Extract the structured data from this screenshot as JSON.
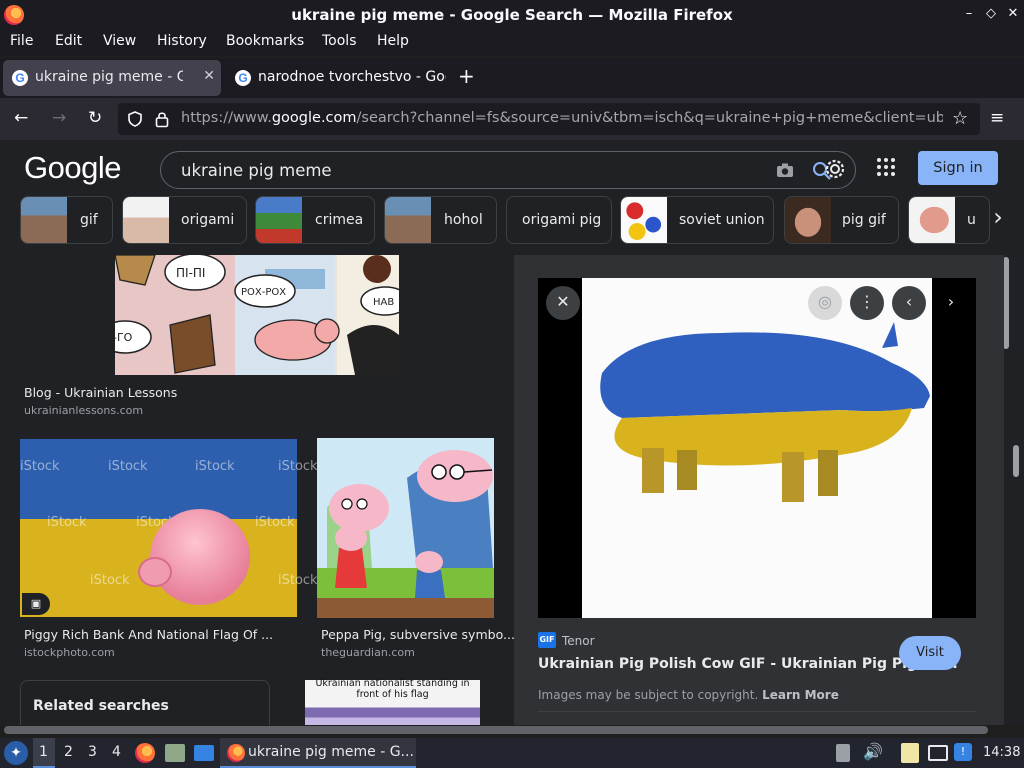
{
  "window": {
    "title": "ukraine pig meme - Google Search — Mozilla Firefox",
    "controls": [
      "–",
      "◇",
      "✕"
    ]
  },
  "menu": [
    "File",
    "Edit",
    "View",
    "History",
    "Bookmarks",
    "Tools",
    "Help"
  ],
  "tabs": [
    {
      "label": "ukraine pig meme - Google Search",
      "active": true
    },
    {
      "label": "narodnoe tvorchestvo - Google Search",
      "active": false
    }
  ],
  "navbar": {
    "url_prefix": "https://www.",
    "url_domain": "google.com",
    "url_rest": "/search?channel=fs&source=univ&tbm=isch&q=ukraine+pig+meme&client=ubuntu"
  },
  "google": {
    "logo": "Google",
    "query": "ukraine pig meme",
    "signin": "Sign in",
    "chips": [
      "gif",
      "origami",
      "crimea",
      "hohol",
      "origami pig",
      "soviet union",
      "pig gif",
      "u"
    ]
  },
  "results": [
    {
      "caption": "Blog - Ukrainian Lessons",
      "source": "ukrainianlessons.com"
    },
    {
      "caption": "Piggy Rich Bank And National Flag Of ...",
      "source": "istockphoto.com"
    },
    {
      "caption": "Peppa Pig, subversive symbo...",
      "source": "theguardian.com"
    }
  ],
  "comic_text": {
    "b1": "ПІ-ПІ",
    "b2": "РОХ-РОХ",
    "b3": "-ГО",
    "b4": "НАВ"
  },
  "istock_watermark": "iStock",
  "related_searches": "Related searches",
  "partial_result_text": "Ukrainian nationalist standing in front of his flag",
  "preview": {
    "source_badge": "GIF",
    "source": "Tenor",
    "title": "Ukrainian Pig Polish Cow GIF - Ukrainian Pig Pig Po...",
    "visit": "Visit",
    "copyright": "Images may be subject to copyright.",
    "learn_more": "Learn More"
  },
  "taskbar": {
    "workspaces": [
      "1",
      "2",
      "3",
      "4"
    ],
    "window_label": "ukraine pig meme - G...",
    "clock": "14:38"
  },
  "colors": {
    "accent": "#8ab4f8",
    "ukraine_blue": "#2f5fbf",
    "ukraine_yellow": "#d9b31e"
  }
}
